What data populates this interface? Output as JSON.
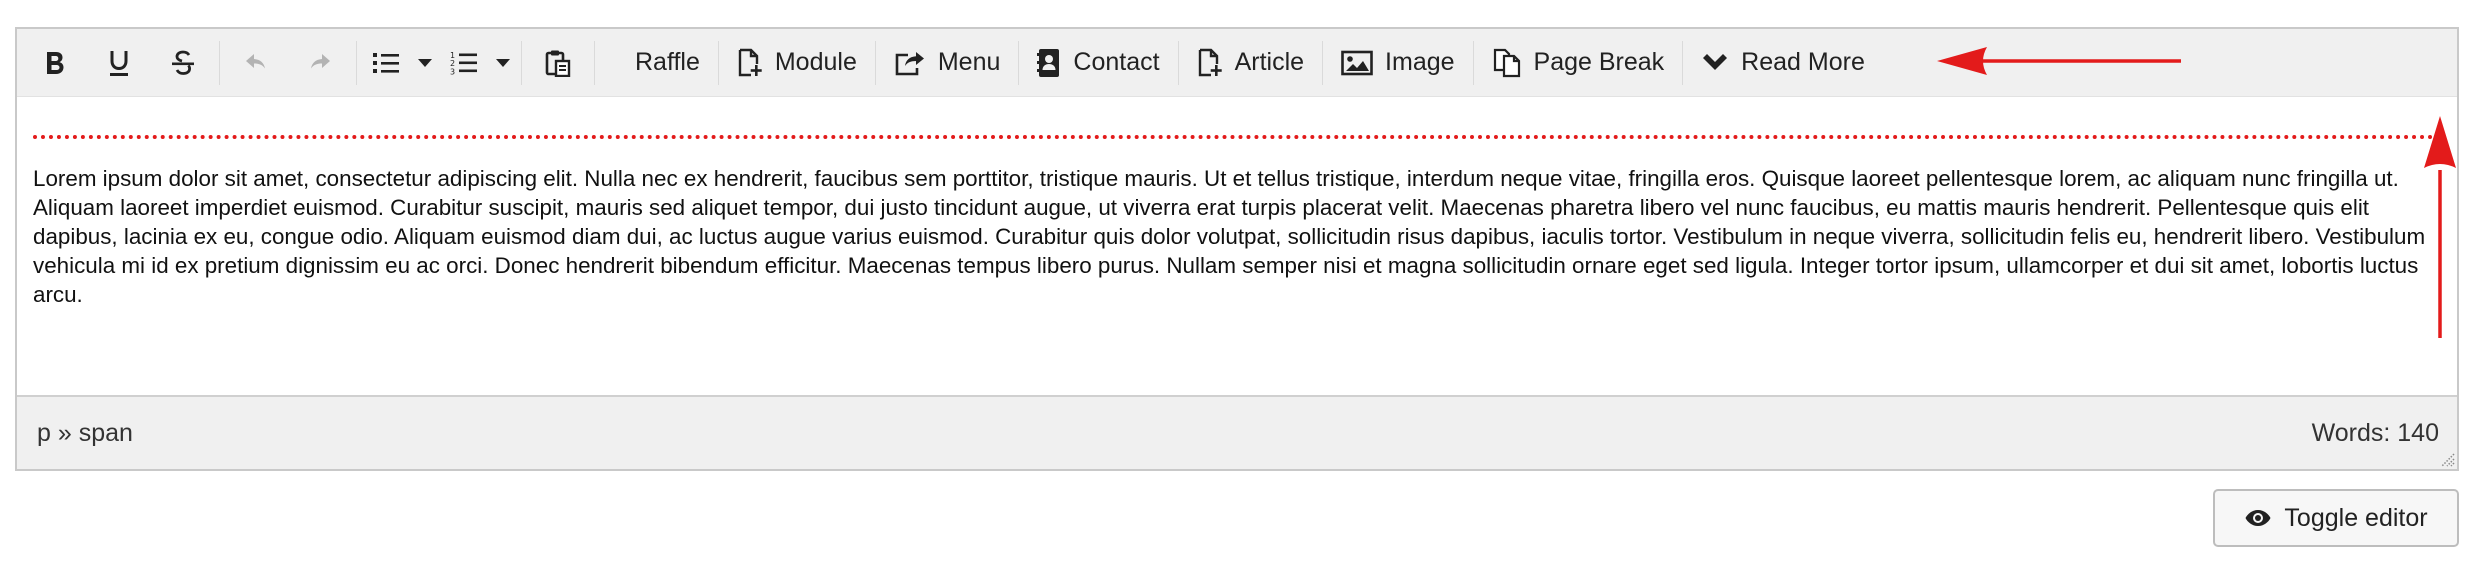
{
  "toolbar": {
    "bold_icon": "bold-icon",
    "underline_icon": "underline-icon",
    "strike_icon": "strikethrough-icon",
    "undo_icon": "undo-icon",
    "redo_icon": "redo-icon",
    "bullet_icon": "bullet-list-icon",
    "numbered_icon": "numbered-list-icon",
    "paste_icon": "paste-icon",
    "raffle_label": "Raffle",
    "module_label": "Module",
    "menu_label": "Menu",
    "contact_label": "Contact",
    "article_label": "Article",
    "image_label": "Image",
    "pagebreak_label": "Page Break",
    "readmore_label": "Read More"
  },
  "content": {
    "paragraph": "Lorem ipsum dolor sit amet, consectetur adipiscing elit. Nulla nec ex hendrerit, faucibus sem porttitor, tristique mauris. Ut et tellus tristique, interdum neque vitae, fringilla eros. Quisque laoreet pellentesque lorem, ac aliquam nunc fringilla ut. Aliquam laoreet imperdiet euismod. Curabitur suscipit, mauris sed aliquet tempor, dui justo tincidunt augue, ut viverra erat turpis placerat velit. Maecenas pharetra libero vel nunc faucibus, eu mattis mauris hendrerit. Pellentesque quis elit dapibus, lacinia ex eu, congue odio. Aliquam euismod diam dui, ac luctus augue varius euismod. Curabitur quis dolor volutpat, sollicitudin risus dapibus, iaculis tortor. Vestibulum in neque viverra, sollicitudin felis eu, hendrerit libero. Vestibulum vehicula mi id ex pretium dignissim eu ac orci. Donec hendrerit bibendum efficitur. Maecenas tempus libero purus. Nullam semper nisi et magna sollicitudin ornare eget sed ligula. Integer tortor ipsum, ullamcorper et dui sit amet, lobortis luctus arcu."
  },
  "statusbar": {
    "path": "p » span",
    "word_count": "Words: 140"
  },
  "toggle": {
    "label": "Toggle editor",
    "icon": "eye-icon"
  },
  "colors": {
    "annotation": "#e31b1b",
    "toolbar_bg": "#f0f0f0"
  }
}
